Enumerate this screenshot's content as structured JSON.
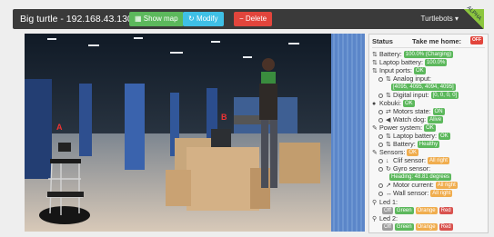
{
  "header": {
    "title": "Big turtle - 192.168.43.130",
    "show_map": "Show map",
    "modify": "Modify",
    "delete": "Delete",
    "robot_menu": "Turtlebots ▾",
    "corner_badge": "ALPHA"
  },
  "photo": {
    "label_a": "A",
    "label_b": "B"
  },
  "status": {
    "heading": "Status",
    "take_me_home": "Take me home:",
    "home_toggle": "OFF",
    "battery": {
      "label": "Battery:",
      "value": "100.0% (Charging)"
    },
    "laptop_battery": {
      "label": "Laptop battery:",
      "value": "100.0%"
    },
    "input_ports": {
      "label": "Input ports:",
      "value": "OK"
    },
    "analog_input": {
      "label": "Analog input:",
      "value": "[4095, 4095, 4094, 4095]"
    },
    "digital_input": {
      "label": "Digital input:",
      "value": "[0, 0, 0, 0]"
    },
    "kobuki": {
      "label": "Kobuki:",
      "value": "OK"
    },
    "motors_state": {
      "label": "Motors state:",
      "value": "ON"
    },
    "watch_dog": {
      "label": "Watch dog:",
      "value": "Alive"
    },
    "power_system": {
      "label": "Power system:",
      "value": "OK"
    },
    "ps_laptop_battery": {
      "label": "Laptop battery:",
      "value": "OK"
    },
    "ps_battery": {
      "label": "Battery:",
      "value": "Healthy"
    },
    "sensors": {
      "label": "Sensors:",
      "value": "OK"
    },
    "clif_sensor": {
      "label": "Clif sensor:",
      "value": "All right"
    },
    "gyro_sensor": {
      "label": "Gyro sensor:",
      "value": "Heading: 48.81 degrees"
    },
    "motor_current": {
      "label": "Motor current:",
      "value": "All right"
    },
    "wall_sensor": {
      "label": "Wall sensor:",
      "value": "All right"
    },
    "led1": {
      "label": "Led 1:",
      "options": [
        "Off",
        "Green",
        "Orange",
        "Red"
      ]
    },
    "led2": {
      "label": "Led 2:",
      "options": [
        "Off",
        "Green",
        "Orange",
        "Red"
      ]
    }
  }
}
